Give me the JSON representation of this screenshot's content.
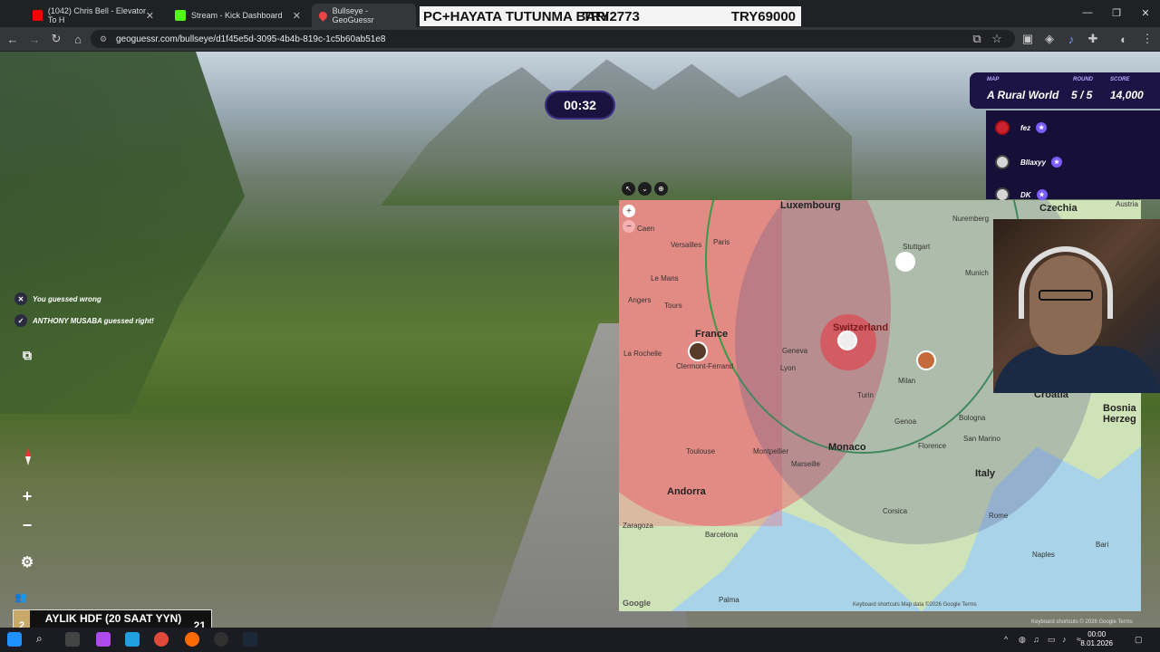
{
  "tabs": [
    {
      "title": "(1042) Chris Bell - Elevator To H",
      "color": "#ff0000"
    },
    {
      "title": "Stream - Kick Dashboard",
      "color": "#53fc18"
    },
    {
      "title": "Bullseye - GeoGuessr",
      "color": "#cccccc"
    }
  ],
  "banner": {
    "left": "PC+HAYATA TUTUNMA BARI",
    "mid": "TRY2773",
    "right": "TRY69000"
  },
  "url": "geoguessr.com/bullseye/d1f45e5d-3095-4b4b-819c-1c5b60ab51e8",
  "timer": "00:32",
  "feed": [
    {
      "icon": "✕",
      "text": "You guessed wrong"
    },
    {
      "icon": "✓",
      "text": "ANTHONY MUSABA guessed right!"
    }
  ],
  "game": {
    "map_label": "MAP",
    "map_value": "A Rural World",
    "round_label": "ROUND",
    "round_value": "5 / 5",
    "score_label": "SCORE",
    "score_value": "14,000"
  },
  "players": [
    "fez",
    "Bllaxyy",
    "DK"
  ],
  "map": {
    "labels": [
      "Luxembourg",
      "Czechia",
      "Paris",
      "Stuttgart",
      "Nuremberg",
      "France",
      "Switzerland",
      "Lyon",
      "Geneva",
      "Milan",
      "Turin",
      "Genoa",
      "Bologna",
      "Croatia",
      "Bosnia Herzeg",
      "Monaco",
      "Florence",
      "San Marino",
      "Toulouse",
      "Montpellier",
      "Marseille",
      "Andorra",
      "Italy",
      "Rome",
      "Zaragoza",
      "Barcelona",
      "Palma",
      "Naples",
      "Bari",
      "Munich",
      "Austria",
      "Le Mans",
      "Angers",
      "La Rochelle",
      "Clermont-Ferrand",
      "Versailles",
      "Caen",
      "Tours",
      "Corsica"
    ],
    "attribution": "Keyboard shortcuts  Map data ©2026 Google  Terms",
    "google": "Google"
  },
  "subgoal": {
    "number": "2",
    "text": "AYLIK HDF (20 SAAT YYN)",
    "count": "21"
  },
  "clock": {
    "time": "00:00",
    "date": "8.01.2026"
  },
  "watermark": "Keyboard shortcuts  © 2026 Google  Terms"
}
